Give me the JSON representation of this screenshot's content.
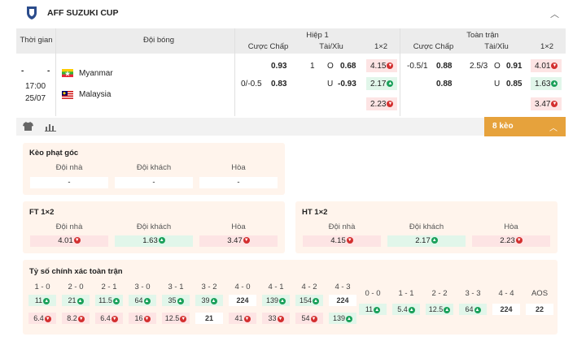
{
  "league": {
    "name": "AFF SUZUKI CUP"
  },
  "header": {
    "time_col": "Thời gian",
    "team_col": "Đội bóng",
    "half1": "Hiệp 1",
    "full": "Toàn trận",
    "handicap": "Cược Chấp",
    "overunder": "Tài/Xỉu",
    "x12": "1×2"
  },
  "match": {
    "score_home": "-",
    "score_away": "-",
    "time": "17:00",
    "date": "25/07",
    "home": "Myanmar",
    "away": "Malaysia"
  },
  "h1": {
    "hc_home": "0.93",
    "hc_line": "0/-0.5",
    "hc_away": "0.83",
    "ou_line": "1",
    "ou_o": "O",
    "ou_o_val": "0.68",
    "ou_u": "U",
    "ou_u_val": "-0.93",
    "x_1": "4.15",
    "x_2": "2.17",
    "x_x": "2.23"
  },
  "ft": {
    "hc_line": "-0.5/1",
    "hc_home": "0.88",
    "hc_away": "0.88",
    "ou_line": "2.5/3",
    "ou_o": "O",
    "ou_o_val": "0.91",
    "ou_u": "U",
    "ou_u_val": "0.85",
    "x_1": "4.01",
    "x_2": "1.63",
    "x_x": "3.47"
  },
  "toolbar": {
    "more_label": "8 kèo"
  },
  "corner": {
    "title": "Kèo phạt góc",
    "home": "Đội nhà",
    "away": "Đội khách",
    "draw": "Hòa",
    "v_home": "-",
    "v_away": "-",
    "v_draw": "-"
  },
  "ft12": {
    "title": "FT 1×2",
    "home": "Đội nhà",
    "away": "Đội khách",
    "draw": "Hòa",
    "v_home": "4.01",
    "v_away": "1.63",
    "v_draw": "3.47"
  },
  "ht12": {
    "title": "HT 1×2",
    "home": "Đội nhà",
    "away": "Đội khách",
    "draw": "Hòa",
    "v_home": "4.15",
    "v_away": "2.17",
    "v_draw": "2.23"
  },
  "correct_score": {
    "title": "Tỷ số chính xác toàn trận",
    "left": [
      {
        "label": "1 - 0",
        "top": "11",
        "bottom": "6.4"
      },
      {
        "label": "2 - 0",
        "top": "21",
        "bottom": "8.2"
      },
      {
        "label": "2 - 1",
        "top": "11.5",
        "bottom": "6.4"
      },
      {
        "label": "3 - 0",
        "top": "64",
        "bottom": "16"
      },
      {
        "label": "3 - 1",
        "top": "35",
        "bottom": "12.5"
      },
      {
        "label": "3 - 2",
        "top": "39",
        "bottom": "21"
      },
      {
        "label": "4 - 0",
        "top": "224",
        "bottom": "41"
      },
      {
        "label": "4 - 1",
        "top": "139",
        "bottom": "33"
      },
      {
        "label": "4 - 2",
        "top": "154",
        "bottom": "54"
      },
      {
        "label": "4 - 3",
        "top": "224",
        "bottom": "139"
      }
    ],
    "right": [
      {
        "label": "0 - 0",
        "value": "11"
      },
      {
        "label": "1 - 1",
        "value": "5.4"
      },
      {
        "label": "2 - 2",
        "value": "12.5"
      },
      {
        "label": "3 - 3",
        "value": "64"
      },
      {
        "label": "4 - 4",
        "value": "224"
      },
      {
        "label": "AOS",
        "value": "22"
      }
    ]
  }
}
